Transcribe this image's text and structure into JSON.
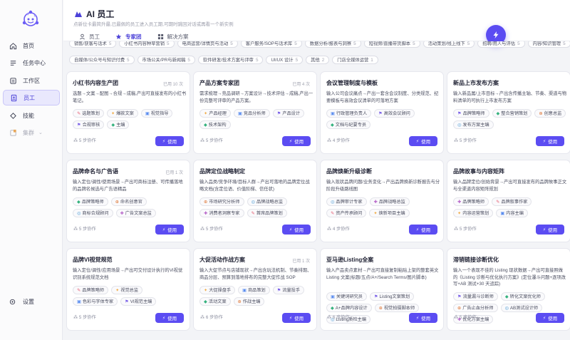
{
  "sidebar": {
    "items": [
      {
        "label": "首页",
        "icon": "home-icon"
      },
      {
        "label": "任务中心",
        "icon": "tasks-icon"
      },
      {
        "label": "工作区",
        "icon": "workspace-icon"
      },
      {
        "label": "员工",
        "icon": "employee-icon",
        "active": true
      },
      {
        "label": "技能",
        "icon": "skill-icon"
      },
      {
        "label": "集群",
        "icon": "cluster-icon"
      }
    ],
    "settings_label": "设置"
  },
  "header": {
    "title": "AI 员工",
    "subtitle": "点新位卡最简升最,已最佩的员工进入员工期,可期时跳回对话或再看一个新实例",
    "tabs": [
      {
        "label": "员工",
        "icon": "person-icon"
      },
      {
        "label": "专家团",
        "icon": "star-icon",
        "active": true
      },
      {
        "label": "解决方案",
        "icon": "grid-icon"
      }
    ]
  },
  "chip_rows": [
    [
      {
        "label": "销售/获客与话术",
        "count": "5"
      },
      {
        "label": "小红书内容种草营销",
        "count": "5"
      },
      {
        "label": "电商运营/详情页与活动",
        "count": "5"
      },
      {
        "label": "客户服务/SOP与话术库",
        "count": "5"
      },
      {
        "label": "数据分析/报表与洞察",
        "count": "5"
      },
      {
        "label": "短视频/直播带货脚本",
        "count": "5"
      },
      {
        "label": "活动策划/线上线下",
        "count": "5"
      },
      {
        "label": "招聘/用人与评估",
        "count": "5"
      },
      {
        "label": "内容/知识管理",
        "count": "5"
      }
    ],
    [
      {
        "label": "自媒体/公众号与知识付费",
        "count": "5"
      },
      {
        "label": "市场公关/PR与新闻稿",
        "count": "5"
      },
      {
        "label": "软件研发/技术方案与评审",
        "count": "5"
      },
      {
        "label": "UI/UX 设计",
        "count": "5"
      },
      {
        "label": "其他",
        "count": "2"
      },
      {
        "label": "门店全媒体运营",
        "count": "1"
      }
    ]
  ],
  "cards": [
    {
      "title": "小红书内容生产团",
      "used": "已用 10 次",
      "desc": "选题→文案→配图→合规→成稿,产出可直接发布的小红书笔记。",
      "tags": [
        "选题策划",
        "爆款文案",
        "视觉指导",
        "合规审核",
        "主编"
      ],
      "steps": "5 步协作"
    },
    {
      "title": "产品方案专家团",
      "used": "已用 4 次",
      "desc": "需求梳理→竞品调研→方案设计→技术评估→成稿,产出一份完整可评审的产品方案。",
      "tags": [
        "产品经理",
        "竞品分析师",
        "产品设计",
        "技术架构"
      ],
      "steps": "5 步协作"
    },
    {
      "title": "会议管理制度与模板",
      "used": "",
      "desc": "输入公司会议痛点→产出一套含会议制度、分类规范、纪要模板与高效会议清单的可落地方案",
      "tags": [
        "行政管理负责人",
        "高效会议顾问",
        "文档与纪要专员"
      ],
      "steps": "4 步协作"
    },
    {
      "title": "新品上市发布方案",
      "used": "",
      "desc": "输入新品属/上市目标→产出含传播主轴、节奏、渠道与物料清单的可执行上市发布方案",
      "tags": [
        "品牌策略师",
        "整合营销策划",
        "创意总监",
        "发布方案主编"
      ],
      "steps": "5 步协作"
    },
    {
      "title": "品牌命名与广告语",
      "used": "已用 1 次",
      "desc": "输入定位/调性/使用场景→产出可商标注册、可传播落地的品牌名候选与广告语精品",
      "tags": [
        "品牌策略师",
        "命名创意官",
        "商标合规顾问",
        "广告文案总监"
      ],
      "steps": "5 步协作"
    },
    {
      "title": "品牌定位战略制定",
      "used": "",
      "desc": "输入品类/竞争环境/目标人群→产出可落地的品牌定位战略文档(含定位语、价值阶梯、信任状)",
      "tags": [
        "市场研究分析师",
        "品牌战略总监",
        "消费者洞察专家",
        "首席品牌策划"
      ],
      "steps": "5 步协作"
    },
    {
      "title": "品牌焕新升级诊断",
      "used": "",
      "desc": "输入现状品牌问题/业务变化→产出品牌焕新诊断报告与分阶段升级路线图",
      "tags": [
        "品牌审计专家",
        "品牌战略总监",
        "资产传承顾问",
        "焕新项目主编"
      ],
      "steps": "4 步协作"
    },
    {
      "title": "品牌故事与内容矩阵",
      "used": "",
      "desc": "输入品牌定位/创始背景→产出可直接发布的品牌故事正文与全渠道内容矩阵规划",
      "tags": [
        "品牌策略师",
        "品牌叙事作家",
        "内容运营策划",
        "内容主编"
      ],
      "steps": "5 步协作"
    },
    {
      "title": "品牌VI视觉规范",
      "used": "",
      "desc": "输入定位/调性/应用场景→产出可交付设计执行的VI视觉识别系统规范文档",
      "tags": [
        "品牌策略师",
        "视觉总监",
        "色彩与字体专家",
        "VI规范主编"
      ],
      "steps": "5 步协作"
    },
    {
      "title": "大促活动作战方案",
      "used": "已用 1 次",
      "desc": "输入大促节点与店铺现状→产出含玩法机制、节奏排期、商品分层、预算到落地排布的完整大促作战 SOP",
      "tags": [
        "大促操盘手",
        "商品策划",
        "流量投手",
        "活动文案",
        "作战主编"
      ],
      "steps": "6 步协作"
    },
    {
      "title": "亚马逊Listing全案",
      "used": "",
      "desc": "输入产品卖点素材→产出可直接复制粘贴上架的整套英文 Listing 文案(标题/五点/A+/Search Terms/图片脚本)",
      "tags": [
        "关键词研究员",
        "Listing文案策划",
        "A+品牌内容设计",
        "视觉拍摄脚本师",
        "Listing质检主编"
      ],
      "steps": "6 步协作"
    },
    {
      "title": "滞销链接诊断优化",
      "used": "",
      "desc": "输入一个表现不佳的 Listing 现状数据→产出可直接照做的《Listing 诊断与优化执行方案》(定位瀑斗问题+逐项改写+AB 测试+30 天追踪)",
      "tags": [
        "流量漏斗诊断师",
        "转化文案优化师",
        "广告止血分析师",
        "AB测试设计师",
        "优化方案主编"
      ],
      "steps": "5 步协作"
    }
  ],
  "use_label": "使用",
  "colors": {
    "accent": "#5b4cf2",
    "active_bg": "#e9e8fd"
  }
}
